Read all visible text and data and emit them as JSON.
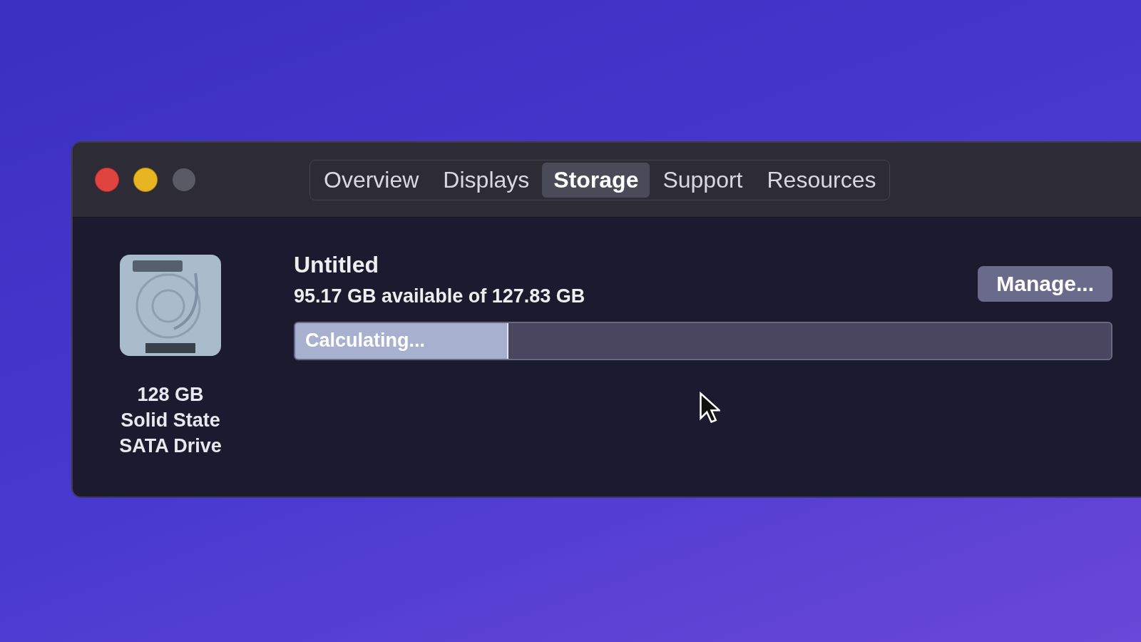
{
  "window": {
    "controls": [
      {
        "kind": "close",
        "color": "#e0443e"
      },
      {
        "kind": "minimize",
        "color": "#e6b521"
      },
      {
        "kind": "zoom",
        "color": "#5a5a66"
      }
    ]
  },
  "tabs": [
    {
      "label": "Overview",
      "selected": false
    },
    {
      "label": "Displays",
      "selected": false
    },
    {
      "label": "Storage",
      "selected": true
    },
    {
      "label": "Support",
      "selected": false
    },
    {
      "label": "Resources",
      "selected": false
    }
  ],
  "disk": {
    "lines": [
      "128 GB",
      "Solid State",
      "SATA Drive"
    ]
  },
  "volume": {
    "name": "Untitled",
    "available": "95.17 GB available of 127.83 GB",
    "bar": {
      "label": "Calculating...",
      "level": 0.26
    },
    "button": "Manage..."
  }
}
